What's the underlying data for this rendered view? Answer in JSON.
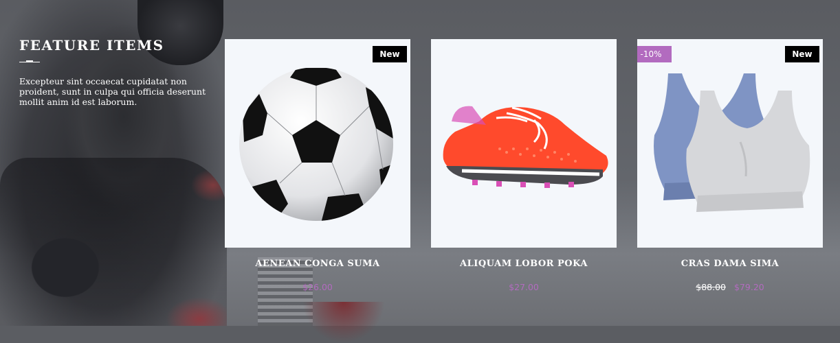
{
  "section": {
    "title": "FEATURE ITEMS",
    "description": "Excepteur sint occaecat cupidatat non proident, sunt in culpa qui officia deserunt mollit anim id est laborum."
  },
  "products": [
    {
      "name": "AENEAN CONGA SUMA",
      "price": "$26.00",
      "old_price": "",
      "badge": "New",
      "sale_badge": "",
      "image": "soccer-ball"
    },
    {
      "name": "ALIQUAM LOBOR POKA",
      "price": "$27.00",
      "old_price": "",
      "badge": "",
      "sale_badge": "",
      "image": "running-shoe"
    },
    {
      "name": "CRAS DAMA SIMA",
      "price": "$79.20",
      "old_price": "$88.00",
      "badge": "New",
      "sale_badge": "-10%",
      "image": "sports-bras"
    }
  ],
  "colors": {
    "accent": "#b26bbf",
    "badge_bg": "#000000",
    "card_bg": "#f4f7fb"
  }
}
